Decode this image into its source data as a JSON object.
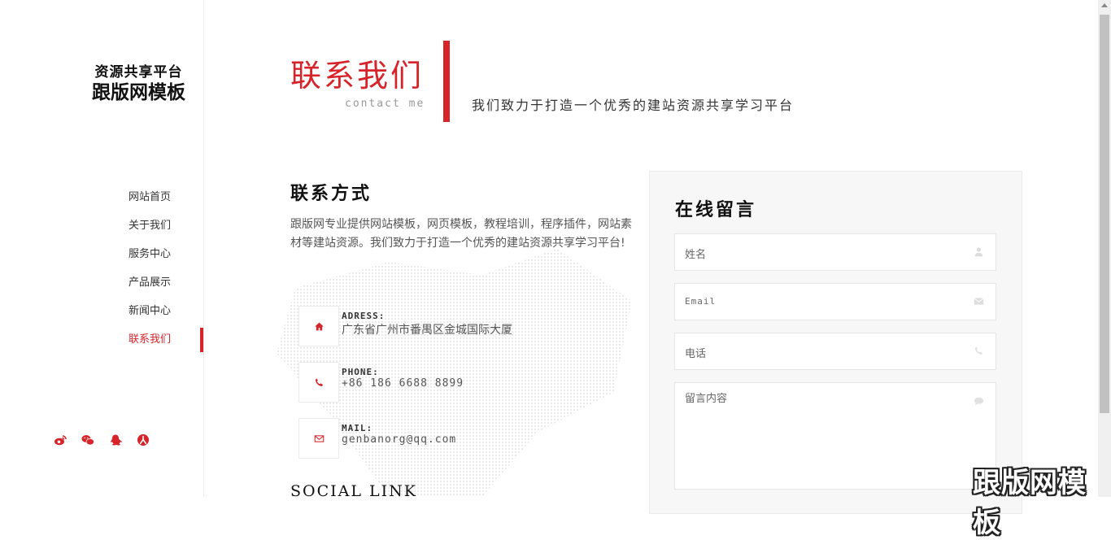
{
  "logo": {
    "line1": "资源共享平台",
    "line2": "跟版网模板"
  },
  "nav": {
    "items": [
      {
        "label": "网站首页"
      },
      {
        "label": "关于我们"
      },
      {
        "label": "服务中心"
      },
      {
        "label": "产品展示"
      },
      {
        "label": "新闻中心"
      },
      {
        "label": "联系我们",
        "active": true
      }
    ]
  },
  "social_icons": [
    "weibo-icon",
    "wechat-icon",
    "qq-icon",
    "renren-icon"
  ],
  "header": {
    "title": "联系我们",
    "subtitle": "contact me",
    "slogan": "我们致力于打造一个优秀的建站资源共享学习平台"
  },
  "contact": {
    "title": "联系方式",
    "description": "跟版网专业提供网站模板，网页模板，教程培训，程序插件，网站素材等建站资源。我们致力于打造一个优秀的建站资源共享学习平台!",
    "address": {
      "label": "ADRESS:",
      "value": "广东省广州市番禺区金城国际大厦"
    },
    "phone": {
      "label": "PHONE:",
      "value": "+86 186 6688 8899"
    },
    "mail": {
      "label": "MAIL:",
      "value": "genbanorg@qq.com"
    },
    "social_title": "SOCIAL LINK"
  },
  "form": {
    "title": "在线留言",
    "name_placeholder": "姓名",
    "email_placeholder": "Email",
    "phone_placeholder": "电话",
    "message_placeholder": "留言内容"
  },
  "watermark": "跟版网模板",
  "colors": {
    "accent": "#d6242a"
  }
}
